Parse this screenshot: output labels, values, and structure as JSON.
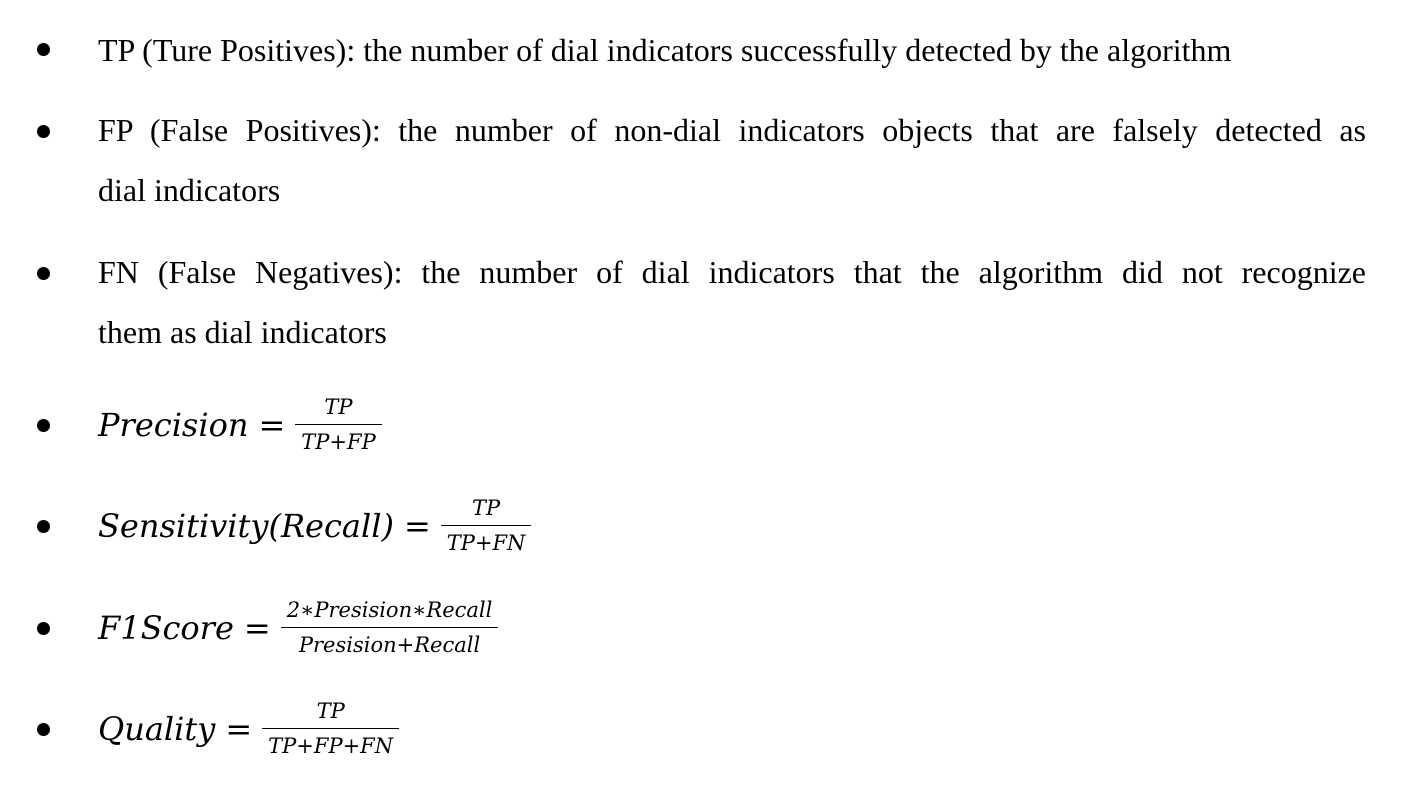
{
  "items": [
    {
      "lines": [
        "TP (Ture Positives): the number of dial indicators successfully detected by the algorithm"
      ]
    },
    {
      "lines": [
        "FP (False Positives): the number of non-dial indicators objects that are falsely detected as",
        "dial indicators"
      ]
    },
    {
      "lines": [
        "FN (False Negatives): the number of dial indicators that the algorithm did not recognize",
        "them as dial indicators"
      ]
    }
  ],
  "formulas": [
    {
      "lhs": "Precision",
      "eq": "=",
      "numerator": "TP",
      "denominator": "TP+FP"
    },
    {
      "lhs": "Sensitivity(Recall)",
      "eq": "=",
      "numerator": "TP",
      "denominator": "TP+FN"
    },
    {
      "lhs": "F1Score",
      "eq": "=",
      "numerator": "2∗Presision∗Recall",
      "denominator": "Presision+Recall"
    },
    {
      "lhs": "Quality",
      "eq": "=",
      "numerator": "TP",
      "denominator": "TP+FP+FN"
    }
  ]
}
